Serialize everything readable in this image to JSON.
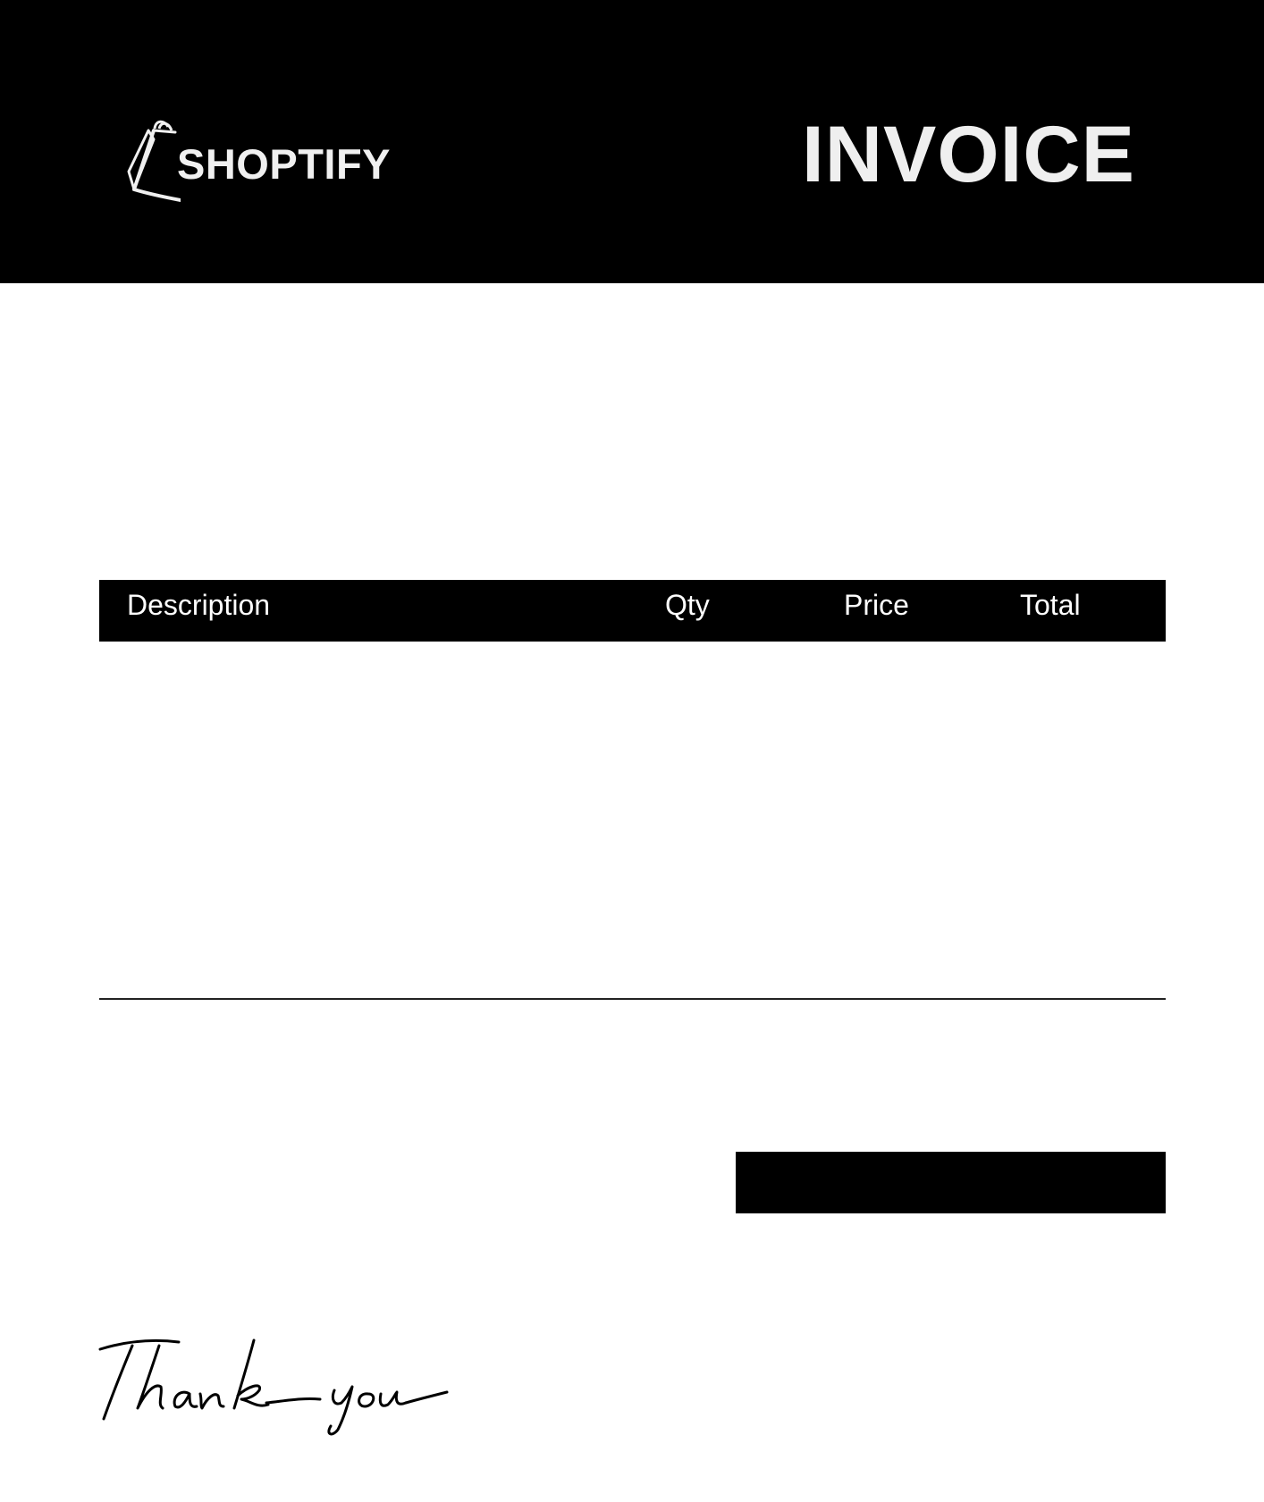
{
  "header": {
    "brand": "SHOPTIFY",
    "logo_icon": "shopping-bag-icon",
    "title": "INVOICE"
  },
  "table": {
    "columns": [
      "Description",
      "Qty",
      "Price",
      "Total"
    ]
  },
  "footer": {
    "closing": "Thank you"
  },
  "colors": {
    "header_background": "#000000",
    "header_text": "#f0f0f0",
    "page_background": "#ffffff",
    "table_header_background": "#000000",
    "table_header_text": "#ffffff",
    "signature_ink": "#000000"
  }
}
